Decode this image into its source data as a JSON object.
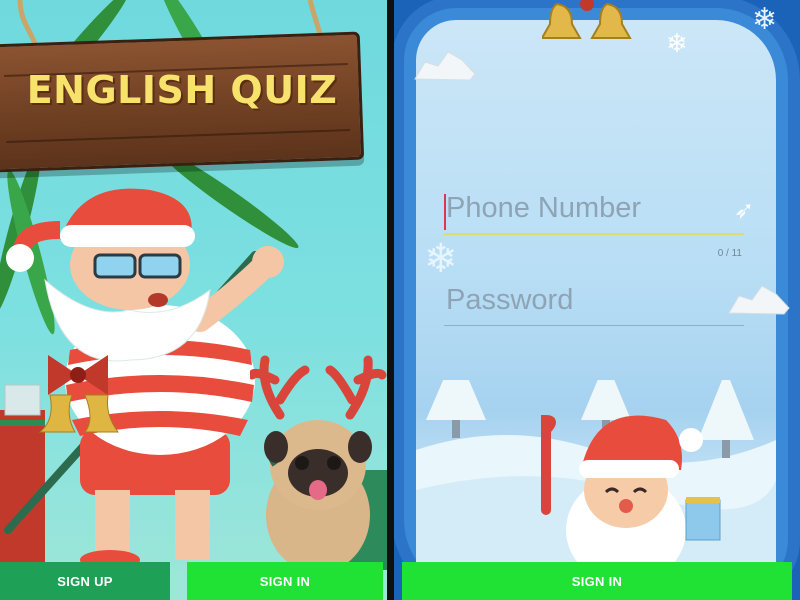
{
  "left_screen": {
    "title": "ENGLISH QUIZ",
    "buttons": {
      "sign_up": "SIGN UP",
      "sign_in": "SIGN IN"
    }
  },
  "right_screen": {
    "phone_field": {
      "placeholder": "Phone Number",
      "counter": "0 / 11"
    },
    "password_field": {
      "placeholder": "Password"
    },
    "buttons": {
      "sign_in": "SIGN IN"
    }
  },
  "colors": {
    "sign_button_green": "#1fe234",
    "signup_green": "#1ea056",
    "title_yellow": "#f7e36b",
    "sky_blue": "#1b63b8"
  }
}
